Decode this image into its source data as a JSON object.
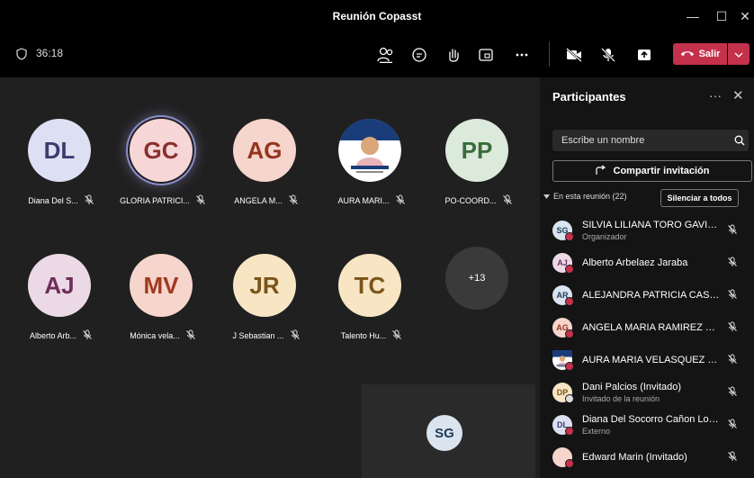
{
  "window": {
    "title": "Reunión Copasst",
    "minimize": "—",
    "maximize": "☐",
    "close": "✕"
  },
  "toolbar": {
    "timer": "36:18",
    "icons": [
      "people-icon",
      "chat-icon",
      "raise-hand-icon",
      "share-tray-icon",
      "more-icon",
      "camera-off-icon",
      "mic-off-icon",
      "share-screen-icon"
    ],
    "leave_label": "Salir",
    "leave_color": "#c4314b"
  },
  "stage": {
    "tiles": [
      {
        "initials": "DL",
        "name": "Diana Del S...",
        "bg": "#dde0f3",
        "fg": "#3b3d6e"
      },
      {
        "initials": "GC",
        "name": "GLORIA PATRICI...",
        "bg": "#f6d6d6",
        "fg": "#8a2f2f",
        "speaking": true
      },
      {
        "initials": "AG",
        "name": "ANGELA M...",
        "bg": "#f6d5cc",
        "fg": "#94341f"
      },
      {
        "initials": "",
        "name": "AURA MARI...",
        "photo": true
      },
      {
        "initials": "PP",
        "name": "PO-COORD...",
        "bg": "#dbeadb",
        "fg": "#3b6b3b"
      },
      {
        "initials": "AJ",
        "name": "Alberto Arb...",
        "bg": "#ecd9e6",
        "fg": "#6e2e5a"
      },
      {
        "initials": "MV",
        "name": "Mónica vela...",
        "bg": "#f6d5cc",
        "fg": "#a2391f"
      },
      {
        "initials": "JR",
        "name": "J Sebastian ...",
        "bg": "#f7e5c4",
        "fg": "#7a5418"
      },
      {
        "initials": "TC",
        "name": "Talento Hu...",
        "bg": "#f7e5c4",
        "fg": "#7a5418"
      }
    ],
    "overflow": "+13",
    "self_initials": "SG"
  },
  "panel": {
    "title": "Participantes",
    "search_placeholder": "Escribe un nombre",
    "share_label": "Compartir invitación",
    "section_label": "En esta reunión (22)",
    "mute_all_label": "Silenciar a todos",
    "participants": [
      {
        "initials": "SG",
        "name": "SILVIA LILIANA TORO GAVIRIA",
        "role": "Organizador",
        "bg": "#d9e4ee",
        "fg": "#1e3b58"
      },
      {
        "initials": "AJ",
        "name": "Alberto Arbelaez Jaraba",
        "role": "",
        "bg": "#ecd9e6",
        "fg": "#6e2e5a"
      },
      {
        "initials": "AR",
        "name": "ALEJANDRA PATRICIA CASTA...",
        "role": "",
        "bg": "#d9e4ee",
        "fg": "#1e3b58"
      },
      {
        "initials": "AG",
        "name": "ANGELA MARIA RAMIREZ GA...",
        "role": "",
        "bg": "#f6d5cc",
        "fg": "#94341f"
      },
      {
        "initials": "",
        "name": "AURA MARIA VELASQUEZ M...",
        "role": "",
        "photo": true
      },
      {
        "initials": "DP",
        "name": "Dani Palcios (Invitado)",
        "role": "Invitado de la reunión",
        "bg": "#f7e5c4",
        "fg": "#7a5418",
        "guest": true
      },
      {
        "initials": "DL",
        "name": "Diana Del Socorro Cañon Lon...",
        "role": "Externo",
        "bg": "#dde0f3",
        "fg": "#3b3d6e"
      },
      {
        "initials": "",
        "name": "Edward Marin (Invitado)",
        "role": "",
        "bg": "#f6d5cc",
        "fg": "#94341f"
      }
    ]
  }
}
